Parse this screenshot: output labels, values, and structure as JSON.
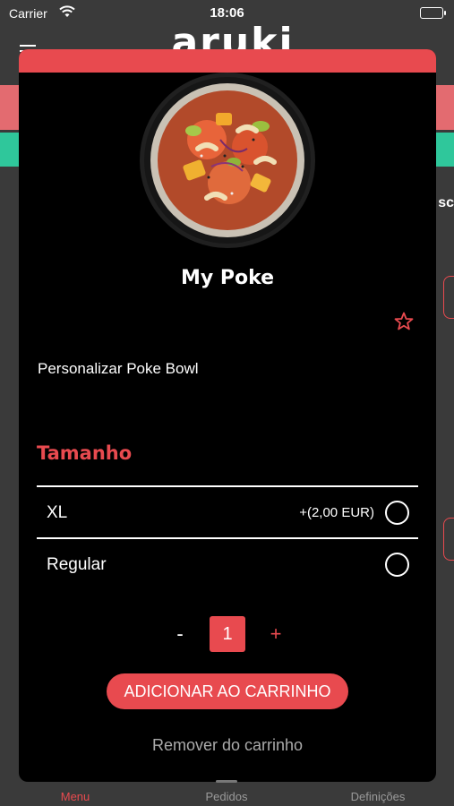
{
  "status_bar": {
    "carrier": "Carrier",
    "time": "18:06"
  },
  "background": {
    "logo": "aruki",
    "peek_text": "sc"
  },
  "product": {
    "title": "My Poke",
    "subtitle": "Personalizar Poke Bowl",
    "image_icon": "poke-bowl-photo",
    "favorite_icon": "star-outline-icon"
  },
  "size_section": {
    "title": "Tamanho",
    "options": [
      {
        "label": "XL",
        "price": "+(2,00 EUR)",
        "selected": false
      },
      {
        "label": "Regular",
        "price": "",
        "selected": false
      }
    ]
  },
  "quantity": {
    "minus": "-",
    "value": "1",
    "plus": "+"
  },
  "actions": {
    "add_to_cart": "ADICIONAR AO CARRINHO",
    "remove_from_cart": "Remover do carrinho"
  },
  "tab_bar": {
    "tabs": [
      {
        "label": "Menu",
        "active": true
      },
      {
        "label": "Pedidos",
        "active": false
      },
      {
        "label": "Definições",
        "active": false
      }
    ]
  },
  "colors": {
    "accent": "#e84a4f",
    "green_band": "#2fc79b",
    "modal_bg": "#000000",
    "page_bg": "#3a3a3a"
  }
}
